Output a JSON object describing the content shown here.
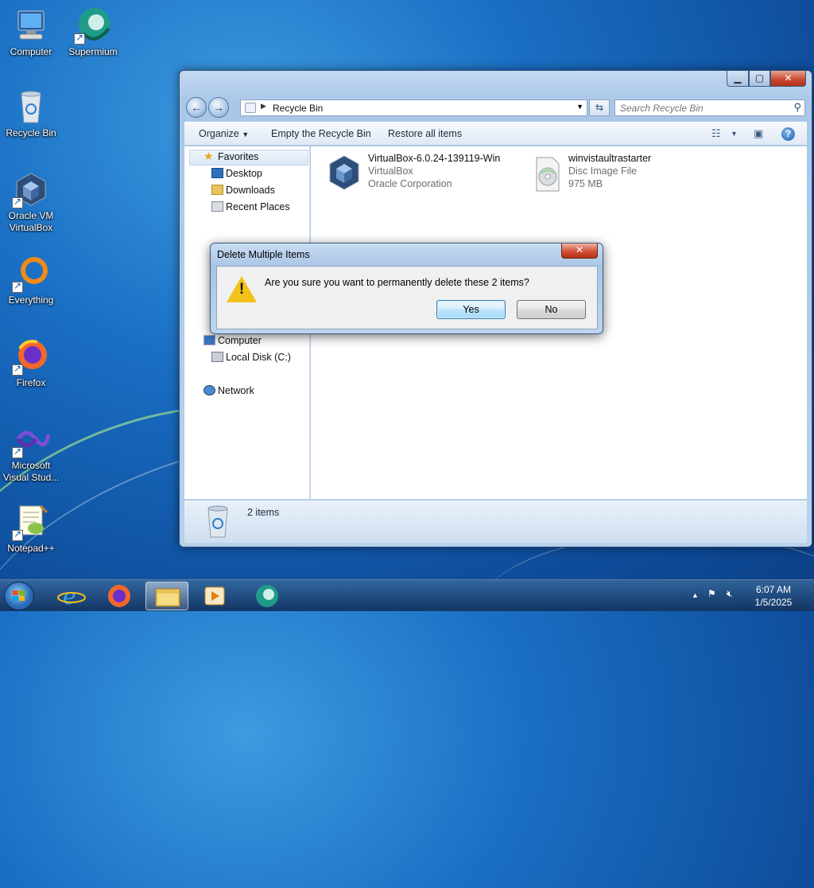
{
  "desktop": {
    "icons": [
      {
        "label": "Computer"
      },
      {
        "label": "Supermium"
      },
      {
        "label": "Recycle Bin"
      },
      {
        "label": "Oracle VM VirtualBox"
      },
      {
        "label": "Everything"
      },
      {
        "label": "Firefox"
      },
      {
        "label": "Microsoft Visual Stud..."
      },
      {
        "label": "Notepad++"
      }
    ]
  },
  "explorer": {
    "address": {
      "crumb": "Recycle Bin"
    },
    "search": {
      "placeholder": "Search Recycle Bin"
    },
    "toolbar": {
      "organize": "Organize",
      "empty": "Empty the Recycle Bin",
      "restore": "Restore all items"
    },
    "nav": {
      "favorites": "Favorites",
      "desktop": "Desktop",
      "downloads": "Downloads",
      "recent": "Recent Places",
      "computer": "Computer",
      "local_disk": "Local Disk (C:)",
      "network": "Network"
    },
    "files": [
      {
        "name": "VirtualBox-6.0.24-139119-Win",
        "line2": "VirtualBox",
        "line3": "Oracle Corporation",
        "icon": "virtualbox-icon"
      },
      {
        "name": "winvistaultrastarter",
        "line2": "Disc Image File",
        "line3": "975 MB",
        "icon": "disc-image-icon"
      }
    ],
    "status": {
      "count": "2 items"
    }
  },
  "dialog": {
    "title": "Delete Multiple Items",
    "message": "Are you sure you want to permanently delete these 2 items?",
    "yes": "Yes",
    "no": "No"
  },
  "taskbar": {
    "time": "6:07 AM",
    "date": "1/5/2025"
  }
}
